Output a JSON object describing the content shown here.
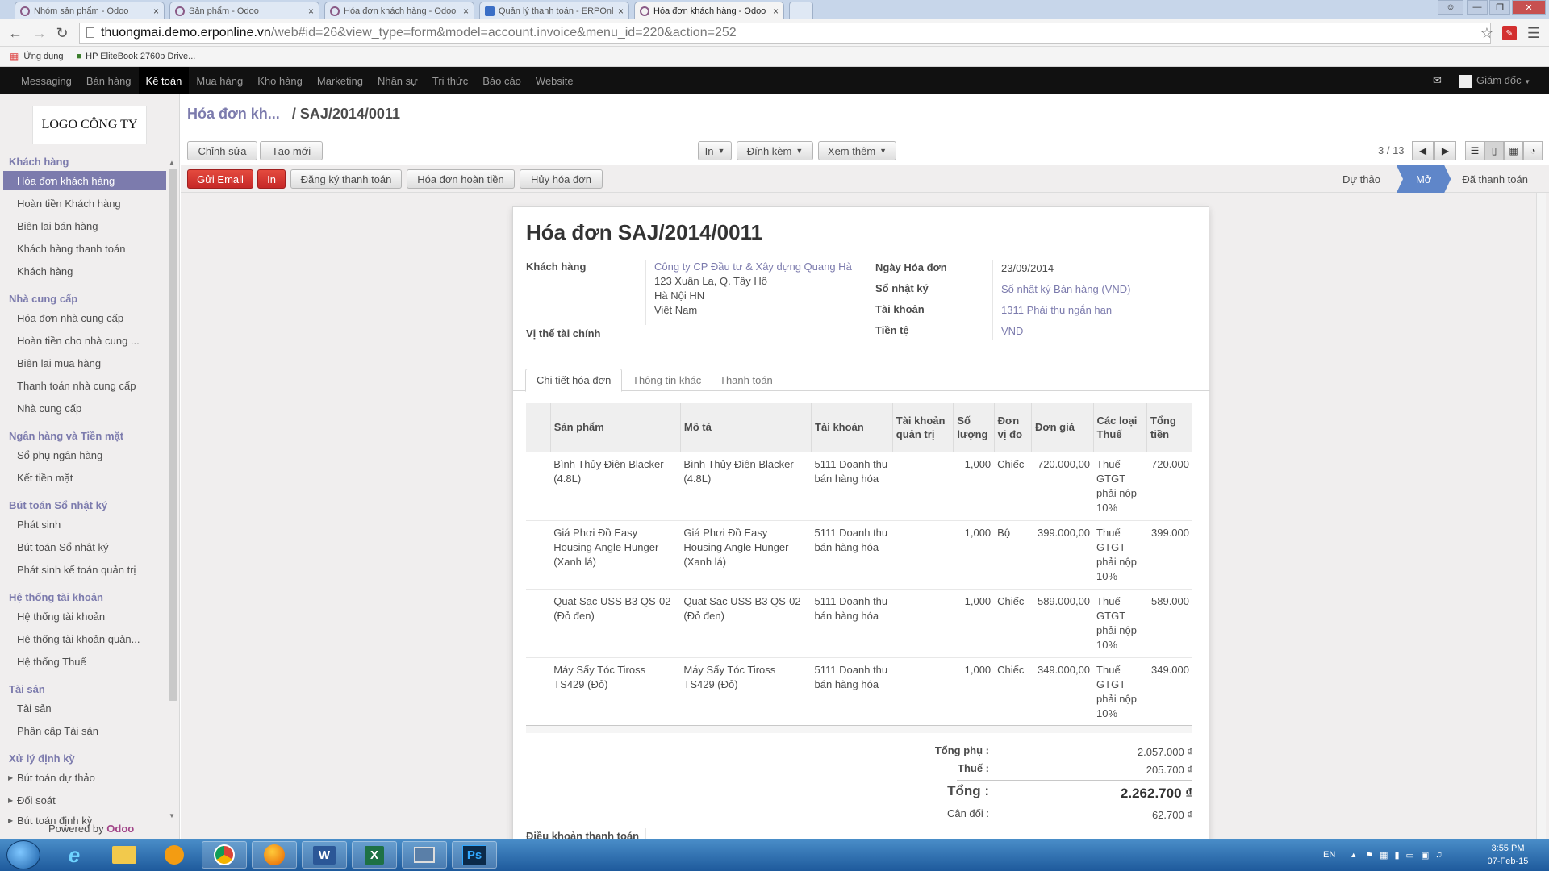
{
  "browser": {
    "tabs": [
      {
        "title": "Nhóm sản phẩm - Odoo",
        "active": false
      },
      {
        "title": "Sản phẩm - Odoo",
        "active": false
      },
      {
        "title": "Hóa đơn khách hàng - Odoo",
        "active": false
      },
      {
        "title": "Quản lý thanh toán - ERPOnlin",
        "active": false
      },
      {
        "title": "Hóa đơn khách hàng - Odoo",
        "active": true
      }
    ],
    "close_glyph": "×",
    "url_host": "thuongmai.demo.erponline.vn",
    "url_path": "/web#id=26&view_type=form&model=account.invoice&menu_id=220&action=252",
    "bookmarks": {
      "apps": "Ứng dụng",
      "item1": "HP EliteBook 2760p Drive..."
    }
  },
  "topmenu": {
    "items": [
      "Messaging",
      "Bán hàng",
      "Kế toán",
      "Mua hàng",
      "Kho hàng",
      "Marketing",
      "Nhân sự",
      "Tri thức",
      "Báo cáo",
      "Website"
    ],
    "active_index": 2,
    "user": "Giám đốc"
  },
  "sidebar": {
    "logo": "LOGO CÔNG TY",
    "sections": [
      {
        "title": "Khách hàng",
        "items": [
          "Hóa đơn khách hàng",
          "Hoàn tiền Khách hàng",
          "Biên lai bán hàng",
          "Khách hàng thanh toán",
          "Khách hàng"
        ]
      },
      {
        "title": "Nhà cung cấp",
        "items": [
          "Hóa đơn nhà cung cấp",
          "Hoàn tiền cho nhà cung ...",
          "Biên lai mua hàng",
          "Thanh toán nhà cung cấp",
          "Nhà cung cấp"
        ]
      },
      {
        "title": "Ngân hàng và Tiền mặt",
        "items": [
          "Sổ phụ ngân hàng",
          "Kết tiền mặt"
        ]
      },
      {
        "title": "Bút toán Sổ nhật ký",
        "items": [
          "Phát sinh",
          "Bút toán Sổ nhật ký",
          "Phát sinh kế toán quản trị"
        ]
      },
      {
        "title": "Hệ thống tài khoản",
        "items": [
          "Hệ thống tài khoản",
          "Hệ thống tài khoản quản...",
          "Hệ thống Thuế"
        ]
      },
      {
        "title": "Tài sản",
        "items": [
          "Tài sản",
          "Phân cấp Tài sản"
        ]
      },
      {
        "title": "Xử lý định kỳ",
        "items": [
          "Bút toán dự thảo",
          "Đối soát",
          "Bút toán định kỳ"
        ]
      }
    ],
    "active_item": "Hóa đơn khách hàng",
    "powered_by": "Powered by",
    "powered_brand": "Odoo"
  },
  "breadcrumb": {
    "parent": "Hóa đơn kh...",
    "separator": "/",
    "current": "SAJ/2014/0011"
  },
  "toolbar": {
    "edit": "Chỉnh sửa",
    "create": "Tạo mới",
    "print": "In",
    "attach": "Đính kèm",
    "more": "Xem thêm",
    "pager": "3 / 13"
  },
  "actions": {
    "send_email": "Gửi Email",
    "print": "In",
    "register_payment": "Đăng ký thanh toán",
    "refund": "Hóa đơn hoàn tiền",
    "cancel": "Hủy hóa đơn"
  },
  "stages": {
    "draft": "Dự thảo",
    "open": "Mở",
    "paid": "Đã thanh toán"
  },
  "invoice": {
    "title": "Hóa đơn SAJ/2014/0011",
    "labels": {
      "customer": "Khách hàng",
      "fiscal_position": "Vị thế tài chính",
      "date": "Ngày Hóa đơn",
      "journal": "Sổ nhật ký",
      "account": "Tài khoản",
      "currency": "Tiền tệ"
    },
    "customer_name": "Công ty CP Đầu tư & Xây dựng Quang Hà",
    "address": [
      "123 Xuân La, Q. Tây Hồ",
      "Hà Nội HN",
      "Việt Nam"
    ],
    "date": "23/09/2014",
    "journal": "Sổ nhật ký Bán hàng (VND)",
    "account": "1311 Phải thu ngắn hạn",
    "currency": "VND"
  },
  "tabs": [
    "Chi tiết hóa đơn",
    "Thông tin khác",
    "Thanh toán"
  ],
  "lines": {
    "headers": {
      "product": "Sản phẩm",
      "desc": "Mô tả",
      "account": "Tài khoản",
      "analytic": "Tài khoản quản trị",
      "qty": "Số lượng",
      "uom": "Đơn vị đo",
      "price": "Đơn giá",
      "tax": "Các loại Thuế",
      "subtotal": "Tổng tiền"
    },
    "rows": [
      {
        "product": "Bình Thủy Điện Blacker (4.8L)",
        "desc": "Bình Thủy Điện Blacker (4.8L)",
        "account": "5111 Doanh thu bán hàng hóa",
        "analytic": "",
        "qty": "1,000",
        "uom": "Chiếc",
        "price": "720.000,00",
        "tax": "Thuế GTGT phải nộp 10%",
        "subtotal": "720.000"
      },
      {
        "product": "Giá Phơi Đồ Easy Housing Angle Hunger (Xanh lá)",
        "desc": "Giá Phơi Đồ Easy Housing Angle Hunger (Xanh lá)",
        "account": "5111 Doanh thu bán hàng hóa",
        "analytic": "",
        "qty": "1,000",
        "uom": "Bộ",
        "price": "399.000,00",
        "tax": "Thuế GTGT phải nộp 10%",
        "subtotal": "399.000"
      },
      {
        "product": "Quạt Sạc USS B3 QS-02 (Đỏ đen)",
        "desc": "Quạt Sạc USS B3 QS-02 (Đỏ đen)",
        "account": "5111 Doanh thu bán hàng hóa",
        "analytic": "",
        "qty": "1,000",
        "uom": "Chiếc",
        "price": "589.000,00",
        "tax": "Thuế GTGT phải nộp 10%",
        "subtotal": "589.000"
      },
      {
        "product": "Máy Sấy Tóc Tiross TS429 (Đỏ)",
        "desc": "Máy Sấy Tóc Tiross TS429 (Đỏ)",
        "account": "5111 Doanh thu bán hàng hóa",
        "analytic": "",
        "qty": "1,000",
        "uom": "Chiếc",
        "price": "349.000,00",
        "tax": "Thuế GTGT phải nộp 10%",
        "subtotal": "349.000"
      }
    ]
  },
  "totals": {
    "subtotal_label": "Tổng phụ :",
    "subtotal": "2.057.000 ₫",
    "tax_label": "Thuế :",
    "tax": "205.700 ₫",
    "total_label": "Tổng :",
    "total": "2.262.700 ₫",
    "residual_label": "Cân đối :",
    "residual": "62.700 ₫"
  },
  "payment_terms_label": "Điều khoản thanh toán",
  "taskbar": {
    "lang": "EN",
    "time": "3:55 PM",
    "date": "07-Feb-15",
    "word": "W",
    "excel": "X",
    "ps": "Ps"
  }
}
